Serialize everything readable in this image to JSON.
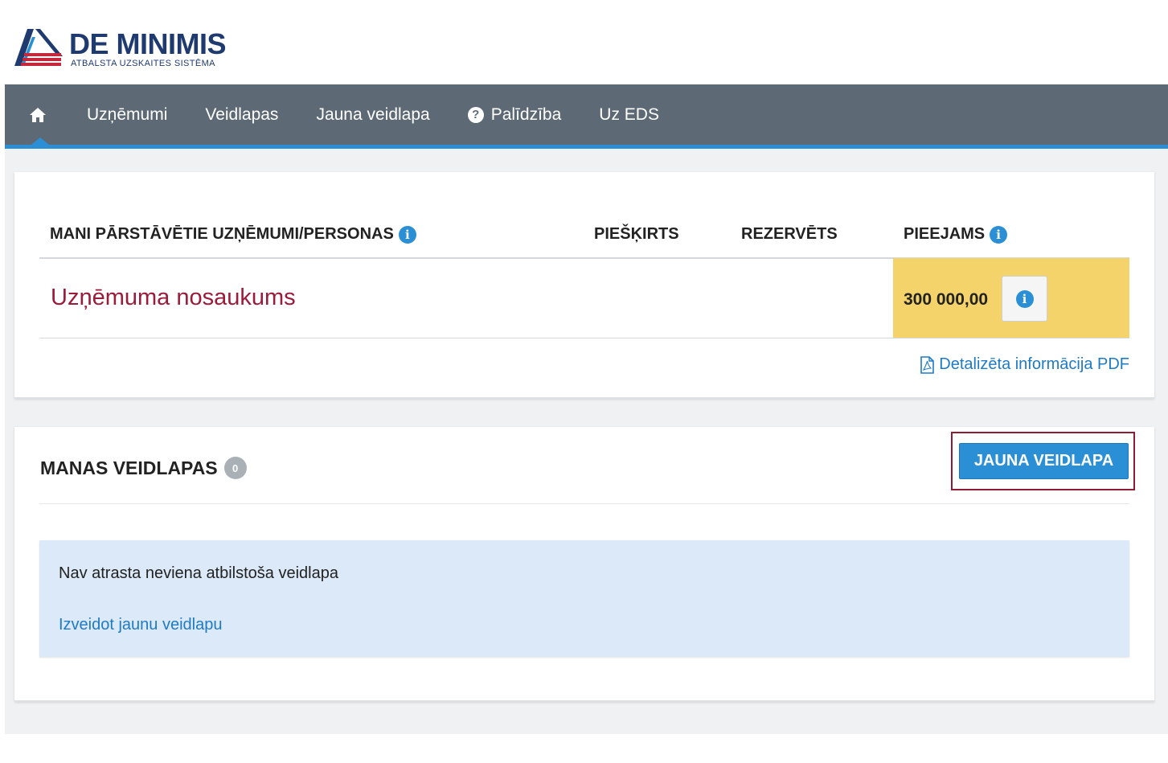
{
  "logo": {
    "title": "DE MINIMIS",
    "subtitle": "ATBALSTA UZSKAITES SISTĒMA"
  },
  "nav": {
    "home_icon": "home-icon",
    "items": [
      "Uzņēmumi",
      "Veidlapas",
      "Jauna veidlapa",
      "Palīdzība",
      "Uz EDS"
    ],
    "help_icon_glyph": "?"
  },
  "companies_card": {
    "headers": {
      "name": "MANI PĀRSTĀVĒTIE UZŅĒMUMI/PERSONAS",
      "granted": "PIEŠĶIRTS",
      "reserved": "REZERVĒTS",
      "available": "PIEEJAMS"
    },
    "row": {
      "name": "Uzņēmuma nosaukums",
      "granted": "",
      "reserved": "",
      "available": "300 000,00"
    },
    "pdf_link": "Detalizēta informācija PDF",
    "info_glyph": "i"
  },
  "forms_card": {
    "title": "MANAS VEIDLAPAS",
    "count": "0",
    "new_button": "JAUNA VEIDLAPA",
    "empty_message": "Nav atrasta neviena atbilstoša veidlapa",
    "create_link": "Izveidot jaunu veidlapu"
  },
  "colors": {
    "navbar": "#5d6a75",
    "accent": "#2b8fd6",
    "company_name": "#9b1b3a",
    "available_cell": "#f4d36a",
    "highlight_frame": "#8f1b34"
  }
}
